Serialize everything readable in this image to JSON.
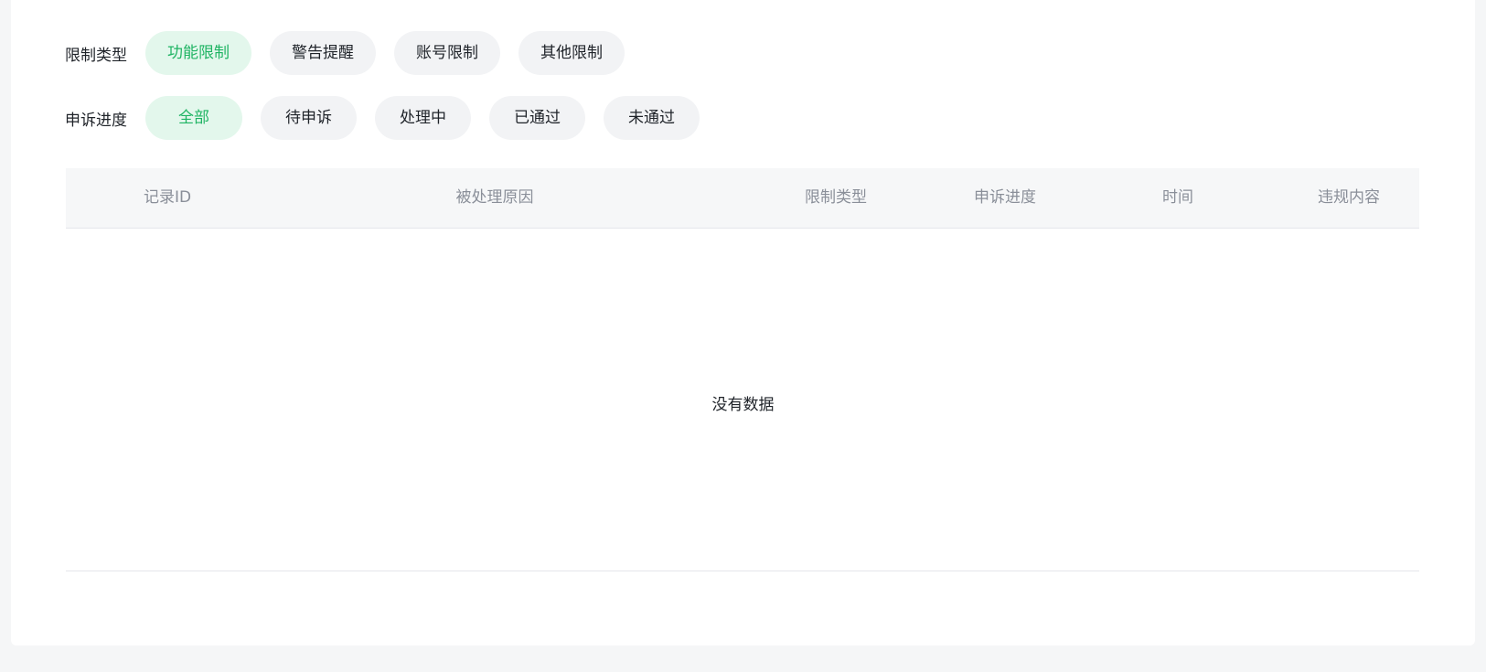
{
  "filters": {
    "restriction_type": {
      "label": "限制类型",
      "options": [
        "功能限制",
        "警告提醒",
        "账号限制",
        "其他限制"
      ],
      "selected": "功能限制"
    },
    "appeal_progress": {
      "label": "申诉进度",
      "options": [
        "全部",
        "待申诉",
        "处理中",
        "已通过",
        "未通过"
      ],
      "selected": "全部"
    }
  },
  "table": {
    "columns": [
      "记录ID",
      "被处理原因",
      "限制类型",
      "申诉进度",
      "时间",
      "违规内容"
    ],
    "rows": [],
    "empty_text": "没有数据"
  },
  "colors": {
    "accent": "#1fb463",
    "accent_bg": "#e3f7ec",
    "chip_bg": "#f2f3f5",
    "page_bg": "#f5f6f7"
  }
}
